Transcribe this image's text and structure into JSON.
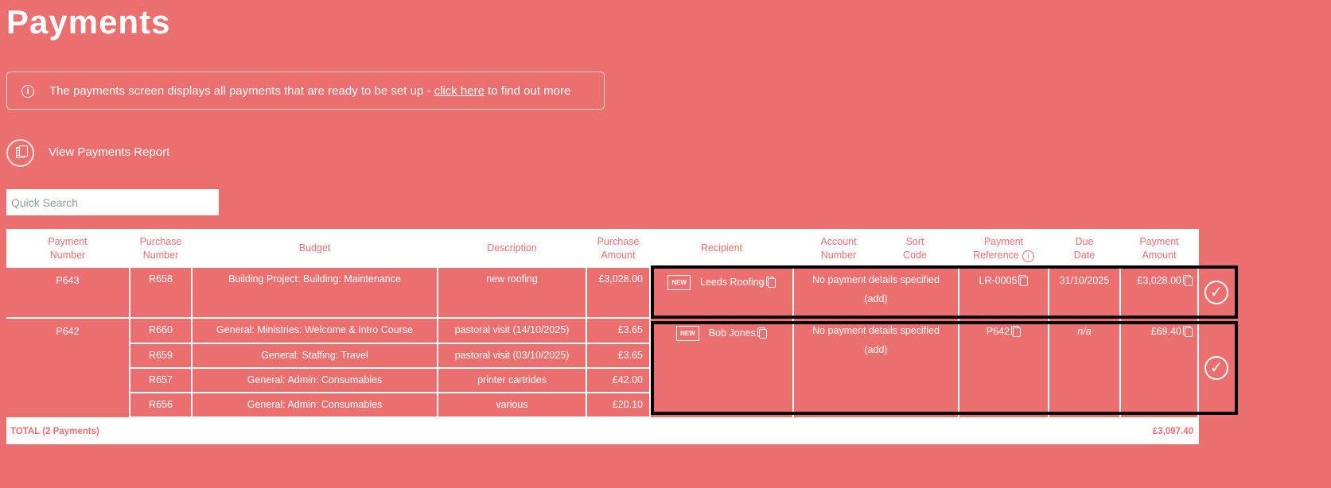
{
  "page_title": "Payments",
  "info_banner": {
    "text_before": "The payments screen displays all payments that are ready to be set up - ",
    "link": "click here",
    "text_after": " to find out more"
  },
  "report_link": "View Payments Report",
  "search": {
    "placeholder": "Quick Search",
    "value": ""
  },
  "headers": [
    "Payment\nNumber",
    "Purchase\nNumber",
    "Budget",
    "Description",
    "Purchase\nAmount",
    "Recipient",
    "Account\nNumber",
    "Sort\nCode",
    "Payment\nReference",
    "Due\nDate",
    "Payment\nAmount"
  ],
  "payments": [
    {
      "payment_number": "P643",
      "recipient": "Leeds Roofing",
      "badge": "NEW",
      "account": "No payment details specified",
      "add": "(add)",
      "reference": "LR-0005",
      "due_date": "31/10/2025",
      "amount": "£3,028.00",
      "purchases": [
        {
          "number": "R658",
          "budget": "Building Project: Building: Maintenance",
          "description": "new roofing",
          "amount": "£3,028.00"
        }
      ]
    },
    {
      "payment_number": "P642",
      "recipient": "Bob Jones",
      "badge": "NEW",
      "account": "No payment details specified",
      "add": "(add)",
      "reference": "P642",
      "due_date": "n/a",
      "amount": "£69.40",
      "purchases": [
        {
          "number": "R660",
          "budget": "General: Ministries: Welcome & Intro Course",
          "description": "pastoral visit (14/10/2025)",
          "amount": "£3.65"
        },
        {
          "number": "R659",
          "budget": "General: Staffing: Travel",
          "description": "pastoral visit (03/10/2025)",
          "amount": "£3.65"
        },
        {
          "number": "R657",
          "budget": "General: Admin: Consumables",
          "description": "printer cartrides",
          "amount": "£42.00"
        },
        {
          "number": "R656",
          "budget": "General: Admin: Consumables",
          "description": "various",
          "amount": "£20.10"
        }
      ]
    }
  ],
  "total": {
    "label": "TOTAL (2 Payments)",
    "amount": "£3,097.40"
  }
}
